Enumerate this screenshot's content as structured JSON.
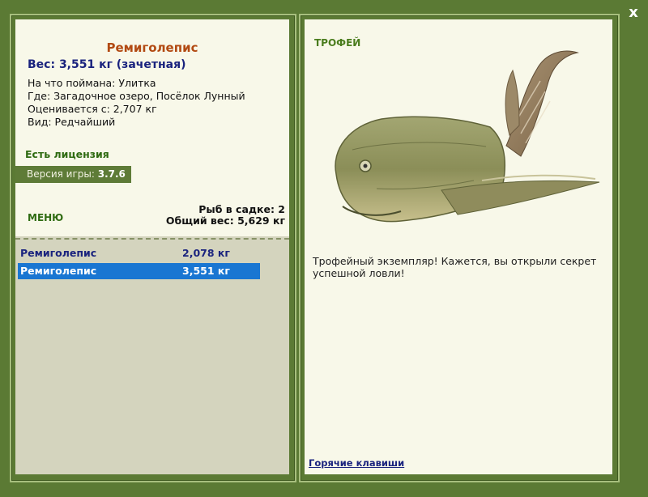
{
  "fish": {
    "name": "Ремиголепис",
    "weight_line": "Вес: 3,551 кг (зачетная)",
    "bait": "На что поймана: Улитка",
    "location": "Где: Загадочное озеро, Посёлок Лунный",
    "rated_from": "Оценивается с: 2,707 кг",
    "kind": "Вид: Редчайший"
  },
  "license": "Есть лицензия",
  "version": {
    "label": "Версия игры:",
    "value": "3.7.6"
  },
  "menu_label": "МЕНЮ",
  "cage": {
    "count": "Рыб в садке: 2",
    "total": "Общий вес: 5,629 кг"
  },
  "catches": [
    {
      "name": "Ремиголепис",
      "weight": "2,078 кг"
    },
    {
      "name": "Ремиголепис",
      "weight": "3,551 кг"
    }
  ],
  "trophy_label": "ТРОФЕЙ",
  "description": "Трофейный экземпляр! Кажется, вы открыли секрет успешной ловли!",
  "hotkeys_label": "Горячие клавиши",
  "close_label": "x",
  "icons": {
    "close": "close-icon",
    "fish": "remigolepis-fish-image"
  },
  "colors": {
    "background": "#5b7a34",
    "panel": "#f8f8e9",
    "list_bg": "#d4d4be",
    "fish_name": "#b24a12",
    "selection": "#1976d2",
    "accent_green": "#4a7c1d"
  }
}
